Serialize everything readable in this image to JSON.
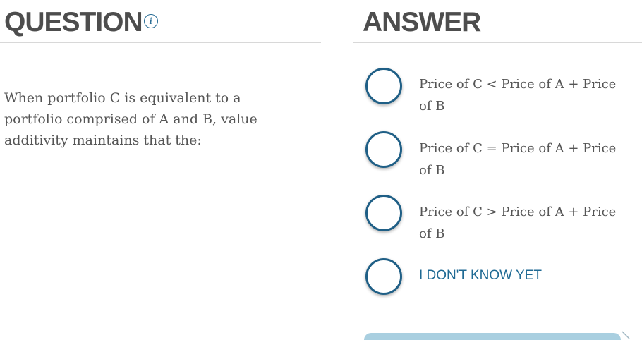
{
  "question": {
    "heading": "QUESTION",
    "info_icon": "info-icon",
    "text": "When portfolio C is equivalent to a portfolio comprised of A and B, value additivity maintains that the:"
  },
  "answer": {
    "heading": "ANSWER",
    "options": [
      {
        "label": "Price of C < Price of A + Price of B",
        "selected": false
      },
      {
        "label": "Price of C = Price of A + Price of B",
        "selected": false
      },
      {
        "label": "Price of C > Price of A + Price of B",
        "selected": false
      },
      {
        "label": "I DON'T KNOW YET",
        "selected": false
      }
    ]
  },
  "colors": {
    "heading": "#4d4d4d",
    "accent": "#1f5f86",
    "body_text": "#555555",
    "link_text": "#1f6a94",
    "bar": "#a9cfe0"
  }
}
